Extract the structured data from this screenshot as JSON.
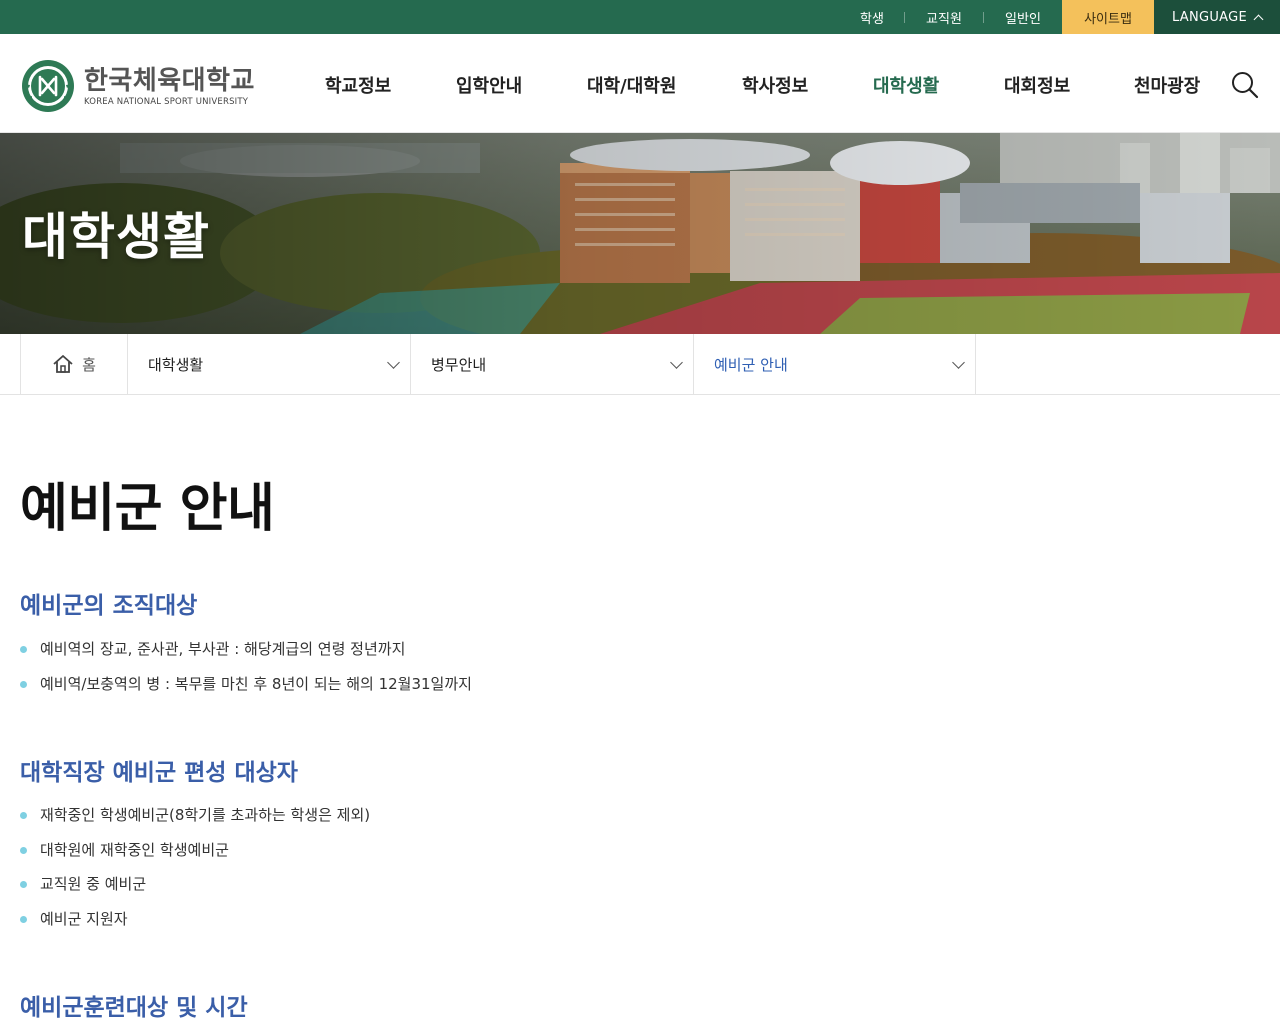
{
  "topbar": {
    "links": [
      "학생",
      "교직원",
      "일반인"
    ],
    "sitemap": "사이트맵",
    "language": "LANGUAGE"
  },
  "header": {
    "logo_name": "한국체육대학교",
    "logo_sub": "KOREA NATIONAL SPORT UNIVERSITY",
    "nav": [
      "학교정보",
      "입학안내",
      "대학/대학원",
      "학사정보",
      "대학생활",
      "대회정보",
      "천마광장"
    ],
    "active_nav": "대학생활"
  },
  "hero": {
    "title": "대학생활"
  },
  "breadcrumb": {
    "home": "홈",
    "level1": "대학생활",
    "level2": "병무안내",
    "level3": "예비군 안내"
  },
  "content": {
    "page_title": "예비군 안내",
    "sections": [
      {
        "title": "예비군의 조직대상",
        "items": [
          "예비역의 장교, 준사관, 부사관 : 해당계급의 연령 정년까지",
          "예비역/보충역의 병 : 복무를 마친 후 8년이 되는 해의 12월31일까지"
        ]
      },
      {
        "title": "대학직장 예비군 편성 대상자",
        "items": [
          "재학중인 학생예비군(8학기를 초과하는 학생은 제외)",
          "대학원에 재학중인 학생예비군",
          "교직원 중 예비군",
          "예비군 지원자"
        ]
      },
      {
        "title": "예비군훈련대상 및 시간",
        "items": []
      }
    ]
  },
  "colors": {
    "topbar": "#256a4f",
    "sitemap": "#f4c15b",
    "active_nav": "#256a4f",
    "section_title": "#3a5ea8",
    "bullet": "#7fd0e2"
  },
  "icons": [
    "home-icon",
    "search-icon",
    "chevron-up-icon",
    "chevron-down-icon",
    "emblem-logo"
  ]
}
